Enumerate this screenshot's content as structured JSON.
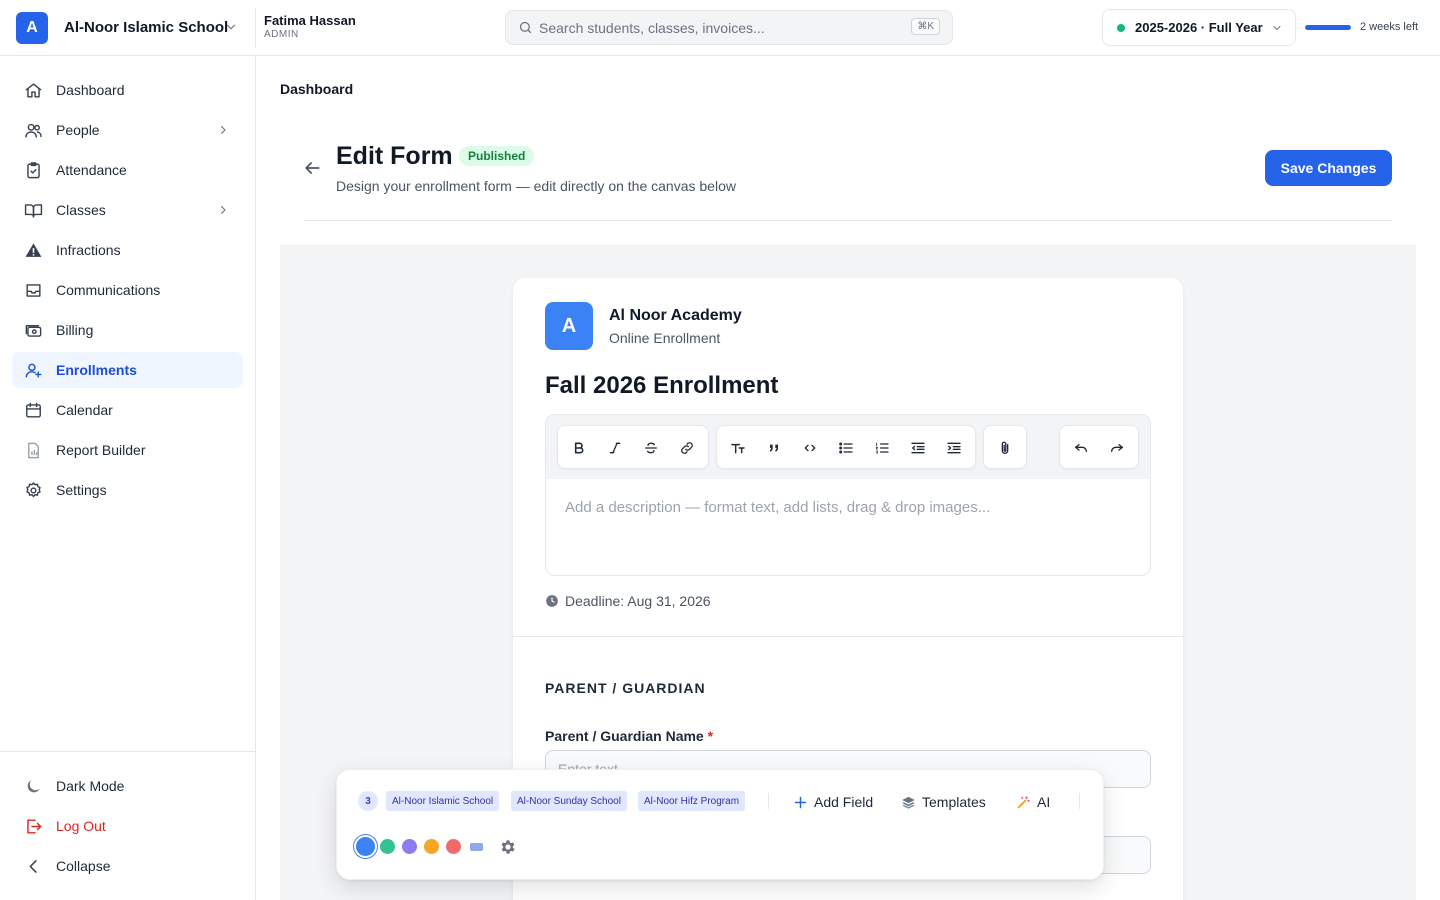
{
  "header": {
    "logo_letter": "A",
    "school_name": "Al-Noor Islamic School",
    "user_name": "Fatima Hassan",
    "user_role": "ADMIN",
    "search_placeholder": "Search students, classes, invoices...",
    "search_shortcut": "⌘K",
    "year_label": "2025-2026 · Full Year",
    "term_progress_percent": 100,
    "weeks_left": "2 weeks left"
  },
  "sidebar": {
    "items": [
      {
        "label": "Dashboard",
        "icon": "home-icon"
      },
      {
        "label": "People",
        "icon": "users-icon",
        "has_submenu": true
      },
      {
        "label": "Attendance",
        "icon": "clipboard-check-icon"
      },
      {
        "label": "Classes",
        "icon": "book-open-icon",
        "has_submenu": true
      },
      {
        "label": "Infractions",
        "icon": "warning-icon"
      },
      {
        "label": "Communications",
        "icon": "inbox-icon"
      },
      {
        "label": "Billing",
        "icon": "money-icon"
      },
      {
        "label": "Enrollments",
        "icon": "user-plus-icon",
        "active": true
      },
      {
        "label": "Calendar",
        "icon": "calendar-icon"
      },
      {
        "label": "Report Builder",
        "icon": "report-icon"
      },
      {
        "label": "Settings",
        "icon": "gear-icon"
      }
    ],
    "bottom": {
      "dark_mode": "Dark Mode",
      "logout": "Log Out",
      "collapse": "Collapse"
    }
  },
  "main": {
    "breadcrumb": "Dashboard",
    "title": "Edit Form",
    "status": "Published",
    "subtitle": "Design your enrollment form — edit directly on the canvas below",
    "save_label": "Save Changes"
  },
  "form": {
    "org_letter": "A",
    "org_name": "Al Noor Academy",
    "org_subtitle": "Online Enrollment",
    "title": "Fall 2026 Enrollment",
    "description_placeholder": "Add a description — format text, add lists, drag & drop images...",
    "deadline": "Deadline: Aug 31, 2026",
    "section_title": "PARENT / GUARDIAN",
    "field_label": "Parent / Guardian Name",
    "field_required_mark": "*",
    "field_placeholder": "Enter text"
  },
  "palette": {
    "count": "3",
    "schools": [
      "Al-Noor Islamic School",
      "Al-Noor Sunday School",
      "Al-Noor Hifz Program"
    ],
    "add_field": "Add Field",
    "templates": "Templates",
    "ai": "AI",
    "swatches": [
      "#3b82f6",
      "#34c38f",
      "#8b7cf6",
      "#f5a623",
      "#f26b6b"
    ],
    "selected_swatch": "#3b82f6"
  },
  "colors": {
    "primary": "#2563eb",
    "active_bg": "#eff6ff",
    "success_bg": "#dcfce7",
    "success_text": "#15803d",
    "danger": "#dc2626"
  }
}
